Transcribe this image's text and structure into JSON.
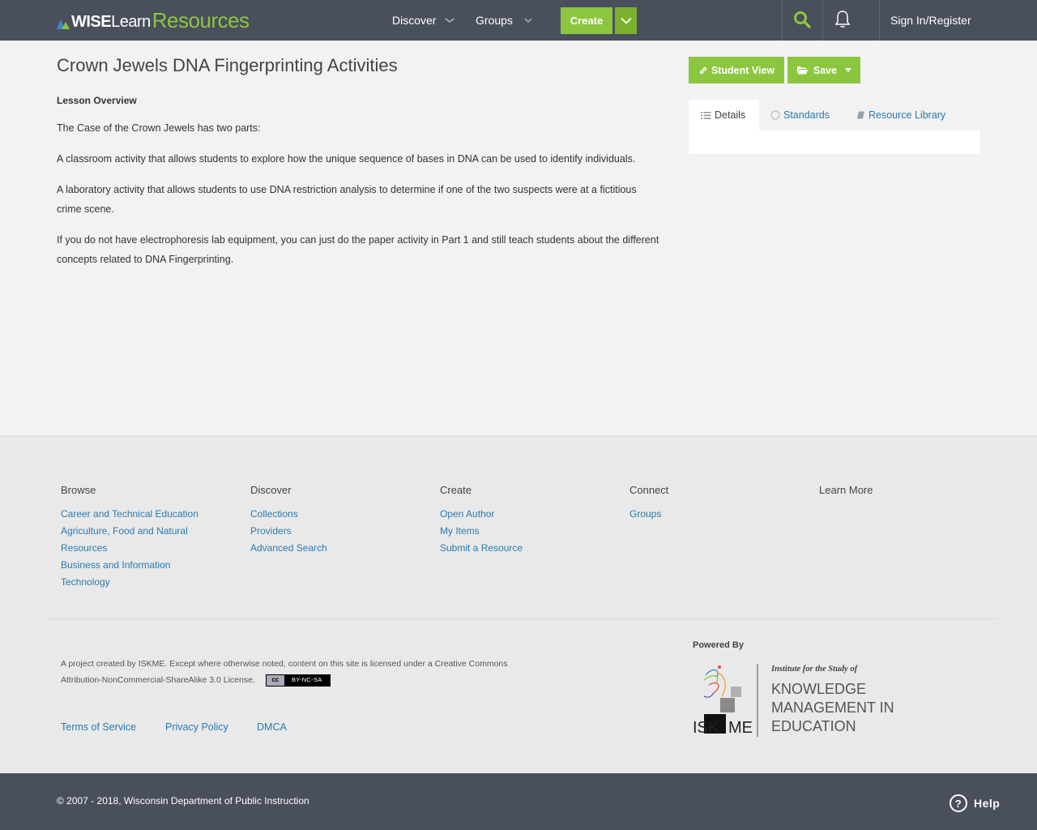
{
  "header": {
    "logo": {
      "wise": "WISE",
      "learn": "Learn",
      "resources": "Resources"
    },
    "nav": [
      {
        "label": "Discover"
      },
      {
        "label": "Groups"
      }
    ],
    "create_label": "Create",
    "signin_label": "Sign In/Register"
  },
  "main": {
    "title": "Crown Jewels DNA Fingerprinting Activities",
    "overview_label": "Lesson Overview",
    "paragraphs": [
      "The Case of the Crown Jewels has two parts:",
      "A classroom activity that allows students to explore how the unique sequence of bases in DNA can be used to identify individuals.",
      "A laboratory activity that allows students to use DNA restriction analysis to determine if one of the two suspects were at a fictitious crime scene.",
      "If you do not have electrophoresis lab equipment, you can just do the paper activity in Part 1 and still teach students about the different concepts related to DNA Fingerprinting."
    ]
  },
  "sidebar": {
    "student_view_label": "Student View",
    "save_label": "Save",
    "tabs": [
      {
        "label": "Details"
      },
      {
        "label": "Standards"
      },
      {
        "label": "Resource Library"
      }
    ]
  },
  "footer": {
    "columns": [
      {
        "heading": "Browse",
        "links": [
          "Career and Technical Education",
          "Agriculture, Food and Natural Resources",
          "Business and Information Technology"
        ]
      },
      {
        "heading": "Discover",
        "links": [
          "Collections",
          "Providers",
          "Advanced Search"
        ]
      },
      {
        "heading": "Create",
        "links": [
          "Open Author",
          "My Items",
          "Submit a Resource"
        ]
      },
      {
        "heading": "Connect",
        "links": [
          "Groups"
        ]
      },
      {
        "heading": "Learn More",
        "links": []
      }
    ],
    "license_text": "A project created by ISKME. Except where otherwise noted, content on this site is licensed under a Creative Commons Attribution-NonCommercial-ShareAlike 3.0 License.",
    "cc_badge": {
      "cc": "cc",
      "terms": "BY-NC-SA"
    },
    "legal_links": [
      "Terms of Service",
      "Privacy Policy",
      "DMCA"
    ],
    "powered_by_label": "Powered By",
    "iskme": {
      "tagline": "Institute for the Study of",
      "line1": "KNOWLEDGE",
      "line2": "MANAGEMENT IN",
      "line3": "EDUCATION",
      "wordmark_left": "ISK",
      "wordmark_right": "ME"
    }
  },
  "bottom": {
    "copyright": "© 2007 - 2018, Wisconsin Department of Public Instruction",
    "help_label": "Help",
    "help_symbol": "?"
  },
  "colors": {
    "accent_green": "#8cc63f",
    "header_bg": "#4a4f5c",
    "link_blue": "#2a7ab0"
  }
}
